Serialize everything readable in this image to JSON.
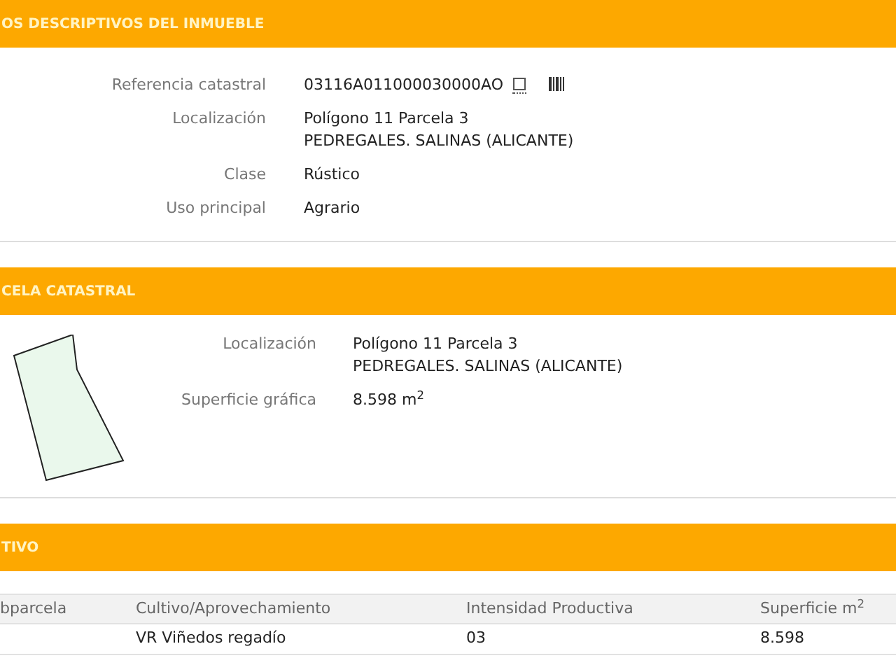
{
  "sections": [
    {
      "title": "OS DESCRIPTIVOS DEL INMUEBLE",
      "kind": "fields",
      "fields": [
        {
          "label": "Referencia catastral",
          "lines": [
            "03116A011000030000AO"
          ],
          "icons": true
        },
        {
          "label": "Localización",
          "lines": [
            "Polígono 11 Parcela 3",
            "PEDREGALES. SALINAS (ALICANTE)"
          ]
        },
        {
          "label": "Clase",
          "lines": [
            "Rústico"
          ]
        },
        {
          "label": "Uso principal",
          "lines": [
            "Agrario"
          ]
        }
      ]
    },
    {
      "title": "CELA CATASTRAL",
      "kind": "parcel",
      "fields": [
        {
          "label": "Localización",
          "lines": [
            "Polígono 11 Parcela 3",
            "PEDREGALES. SALINAS (ALICANTE)"
          ]
        },
        {
          "label": "Superficie gráfica",
          "lines": [
            "8.598 m$^{2}$"
          ]
        }
      ]
    },
    {
      "title": "TIVO",
      "kind": "table",
      "columns": [
        "bparcela",
        "Cultivo/Aprovechamiento",
        "Intensidad Productiva",
        "Superficie m$^{2}$"
      ],
      "rows": [
        [
          "",
          "VR Viñedos regadío",
          "03",
          "8.598"
        ]
      ]
    }
  ]
}
